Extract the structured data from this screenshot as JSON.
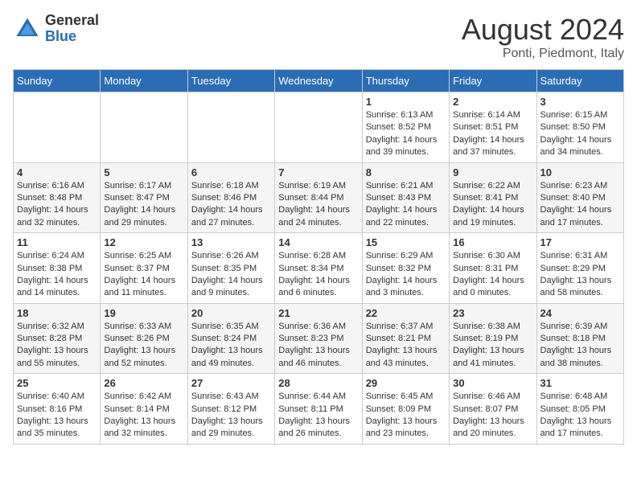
{
  "header": {
    "logo_general": "General",
    "logo_blue": "Blue",
    "month_title": "August 2024",
    "location": "Ponti, Piedmont, Italy"
  },
  "days_of_week": [
    "Sunday",
    "Monday",
    "Tuesday",
    "Wednesday",
    "Thursday",
    "Friday",
    "Saturday"
  ],
  "weeks": [
    [
      {
        "day": "",
        "info": ""
      },
      {
        "day": "",
        "info": ""
      },
      {
        "day": "",
        "info": ""
      },
      {
        "day": "",
        "info": ""
      },
      {
        "day": "1",
        "info": "Sunrise: 6:13 AM\nSunset: 8:52 PM\nDaylight: 14 hours and 39 minutes."
      },
      {
        "day": "2",
        "info": "Sunrise: 6:14 AM\nSunset: 8:51 PM\nDaylight: 14 hours and 37 minutes."
      },
      {
        "day": "3",
        "info": "Sunrise: 6:15 AM\nSunset: 8:50 PM\nDaylight: 14 hours and 34 minutes."
      }
    ],
    [
      {
        "day": "4",
        "info": "Sunrise: 6:16 AM\nSunset: 8:48 PM\nDaylight: 14 hours and 32 minutes."
      },
      {
        "day": "5",
        "info": "Sunrise: 6:17 AM\nSunset: 8:47 PM\nDaylight: 14 hours and 29 minutes."
      },
      {
        "day": "6",
        "info": "Sunrise: 6:18 AM\nSunset: 8:46 PM\nDaylight: 14 hours and 27 minutes."
      },
      {
        "day": "7",
        "info": "Sunrise: 6:19 AM\nSunset: 8:44 PM\nDaylight: 14 hours and 24 minutes."
      },
      {
        "day": "8",
        "info": "Sunrise: 6:21 AM\nSunset: 8:43 PM\nDaylight: 14 hours and 22 minutes."
      },
      {
        "day": "9",
        "info": "Sunrise: 6:22 AM\nSunset: 8:41 PM\nDaylight: 14 hours and 19 minutes."
      },
      {
        "day": "10",
        "info": "Sunrise: 6:23 AM\nSunset: 8:40 PM\nDaylight: 14 hours and 17 minutes."
      }
    ],
    [
      {
        "day": "11",
        "info": "Sunrise: 6:24 AM\nSunset: 8:38 PM\nDaylight: 14 hours and 14 minutes."
      },
      {
        "day": "12",
        "info": "Sunrise: 6:25 AM\nSunset: 8:37 PM\nDaylight: 14 hours and 11 minutes."
      },
      {
        "day": "13",
        "info": "Sunrise: 6:26 AM\nSunset: 8:35 PM\nDaylight: 14 hours and 9 minutes."
      },
      {
        "day": "14",
        "info": "Sunrise: 6:28 AM\nSunset: 8:34 PM\nDaylight: 14 hours and 6 minutes."
      },
      {
        "day": "15",
        "info": "Sunrise: 6:29 AM\nSunset: 8:32 PM\nDaylight: 14 hours and 3 minutes."
      },
      {
        "day": "16",
        "info": "Sunrise: 6:30 AM\nSunset: 8:31 PM\nDaylight: 14 hours and 0 minutes."
      },
      {
        "day": "17",
        "info": "Sunrise: 6:31 AM\nSunset: 8:29 PM\nDaylight: 13 hours and 58 minutes."
      }
    ],
    [
      {
        "day": "18",
        "info": "Sunrise: 6:32 AM\nSunset: 8:28 PM\nDaylight: 13 hours and 55 minutes."
      },
      {
        "day": "19",
        "info": "Sunrise: 6:33 AM\nSunset: 8:26 PM\nDaylight: 13 hours and 52 minutes."
      },
      {
        "day": "20",
        "info": "Sunrise: 6:35 AM\nSunset: 8:24 PM\nDaylight: 13 hours and 49 minutes."
      },
      {
        "day": "21",
        "info": "Sunrise: 6:36 AM\nSunset: 8:23 PM\nDaylight: 13 hours and 46 minutes."
      },
      {
        "day": "22",
        "info": "Sunrise: 6:37 AM\nSunset: 8:21 PM\nDaylight: 13 hours and 43 minutes."
      },
      {
        "day": "23",
        "info": "Sunrise: 6:38 AM\nSunset: 8:19 PM\nDaylight: 13 hours and 41 minutes."
      },
      {
        "day": "24",
        "info": "Sunrise: 6:39 AM\nSunset: 8:18 PM\nDaylight: 13 hours and 38 minutes."
      }
    ],
    [
      {
        "day": "25",
        "info": "Sunrise: 6:40 AM\nSunset: 8:16 PM\nDaylight: 13 hours and 35 minutes."
      },
      {
        "day": "26",
        "info": "Sunrise: 6:42 AM\nSunset: 8:14 PM\nDaylight: 13 hours and 32 minutes."
      },
      {
        "day": "27",
        "info": "Sunrise: 6:43 AM\nSunset: 8:12 PM\nDaylight: 13 hours and 29 minutes."
      },
      {
        "day": "28",
        "info": "Sunrise: 6:44 AM\nSunset: 8:11 PM\nDaylight: 13 hours and 26 minutes."
      },
      {
        "day": "29",
        "info": "Sunrise: 6:45 AM\nSunset: 8:09 PM\nDaylight: 13 hours and 23 minutes."
      },
      {
        "day": "30",
        "info": "Sunrise: 6:46 AM\nSunset: 8:07 PM\nDaylight: 13 hours and 20 minutes."
      },
      {
        "day": "31",
        "info": "Sunrise: 6:48 AM\nSunset: 8:05 PM\nDaylight: 13 hours and 17 minutes."
      }
    ]
  ]
}
